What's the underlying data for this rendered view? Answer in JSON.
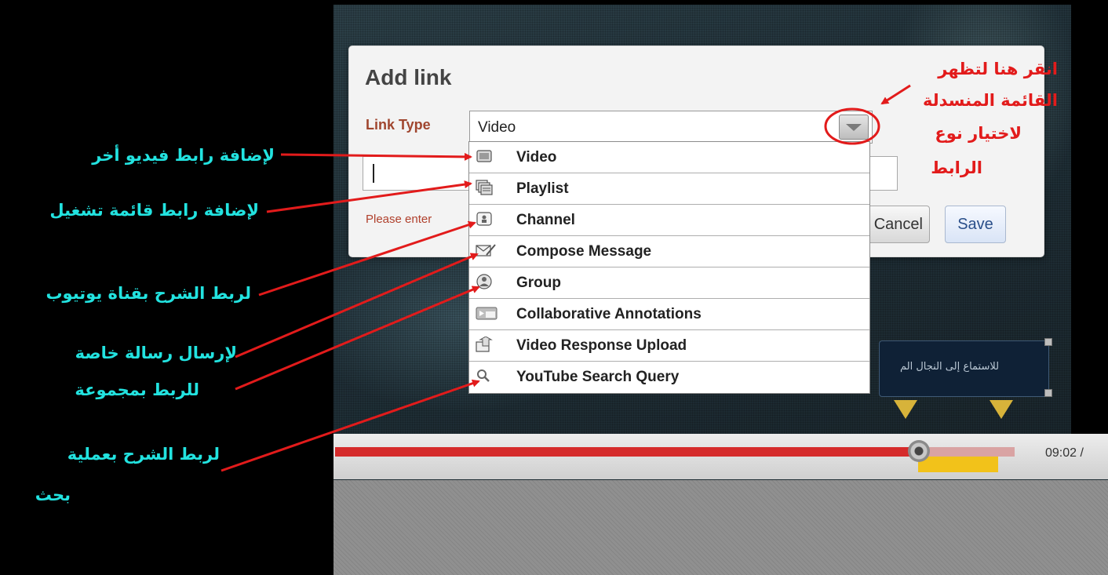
{
  "player": {
    "time": "09:02 /",
    "progress_played_fraction": 0.76,
    "annotation_text": "للاستماع إلى النجال الم"
  },
  "dialog": {
    "title": "Add link",
    "link_type_label": "Link Type",
    "selected_type": "Video",
    "help_text": "Please enter",
    "cancel_label": "Cancel",
    "save_label": "Save"
  },
  "menu": {
    "items": [
      {
        "label": "Video",
        "icon": "video-icon"
      },
      {
        "label": "Playlist",
        "icon": "playlist-icon"
      },
      {
        "label": "Channel",
        "icon": "channel-icon"
      },
      {
        "label": "Compose Message",
        "icon": "envelope-icon"
      },
      {
        "label": "Group",
        "icon": "group-icon"
      },
      {
        "label": "Collaborative Annotations",
        "icon": "annotations-icon"
      },
      {
        "label": "Video Response Upload",
        "icon": "upload-icon"
      },
      {
        "label": "YouTube Search Query",
        "icon": "search-icon"
      }
    ]
  },
  "annotations": {
    "video": "لإضافة رابط فيديو أخر",
    "playlist": "لإضافة رابط قائمة تشغيل",
    "channel": "لربط الشرح بقناة يوتيوب",
    "message": "لإرسال رسالة خاصة",
    "group": "للربط بمجموعة",
    "search_line1": "لربط الشرح بعملية",
    "search_line2": "بحث",
    "dropdown_line1": "انقر هنا لتظهر",
    "dropdown_line2": "القائمة المنسدلة",
    "dropdown_line3": "لاختيار نوع",
    "dropdown_line4": "الرابط"
  },
  "colors": {
    "annotation_cyan": "#22e3e0",
    "annotation_red": "#e21b1b",
    "progress_red": "#d52b2b"
  }
}
